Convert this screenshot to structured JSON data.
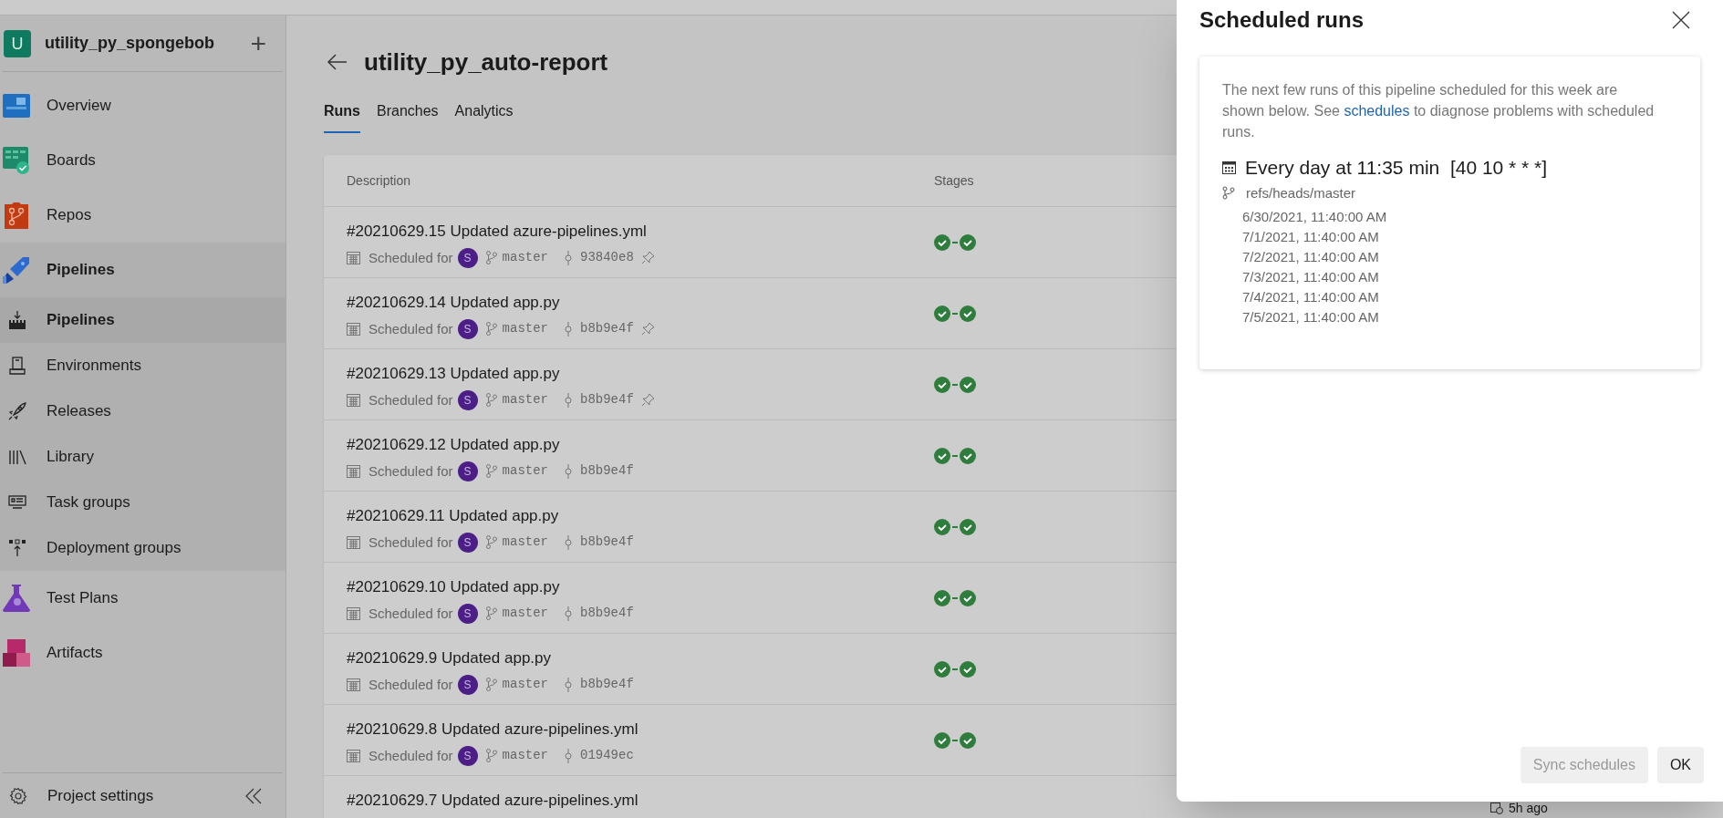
{
  "project": {
    "initial": "U",
    "name": "utility_py_spongebob",
    "add": "+"
  },
  "sidebar": {
    "items": [
      {
        "label": "Overview",
        "selected": false
      },
      {
        "label": "Boards",
        "selected": false
      },
      {
        "label": "Repos",
        "selected": false
      },
      {
        "label": "Pipelines",
        "selected": true,
        "expanded": true,
        "children": [
          {
            "label": "Pipelines",
            "selected": true
          },
          {
            "label": "Environments",
            "selected": false
          },
          {
            "label": "Releases",
            "selected": false
          },
          {
            "label": "Library",
            "selected": false
          },
          {
            "label": "Task groups",
            "selected": false
          },
          {
            "label": "Deployment groups",
            "selected": false
          }
        ]
      },
      {
        "label": "Test Plans",
        "selected": false
      },
      {
        "label": "Artifacts",
        "selected": false
      }
    ],
    "footer": "Project settings"
  },
  "page": {
    "title": "utility_py_auto-report",
    "tabs": [
      {
        "label": "Runs",
        "selected": true
      },
      {
        "label": "Branches",
        "selected": false
      },
      {
        "label": "Analytics",
        "selected": false
      }
    ]
  },
  "table": {
    "columns": [
      "Description",
      "Stages"
    ],
    "rows": [
      {
        "title": "#20210629.15 Updated azure-pipelines.yml",
        "trigger": "Scheduled for",
        "avatar": "S",
        "branch": "master",
        "commit": "93840e8",
        "pinned": true,
        "stages": [
          {
            "passed": true
          },
          {
            "passed": true
          }
        ]
      },
      {
        "title": "#20210629.14 Updated app.py",
        "trigger": "Scheduled for",
        "avatar": "S",
        "branch": "master",
        "commit": "b8b9e4f",
        "pinned": true,
        "stages": [
          {
            "passed": true
          },
          {
            "passed": true
          }
        ]
      },
      {
        "title": "#20210629.13 Updated app.py",
        "trigger": "Scheduled for",
        "avatar": "S",
        "branch": "master",
        "commit": "b8b9e4f",
        "pinned": true,
        "stages": [
          {
            "passed": true
          },
          {
            "passed": true
          }
        ]
      },
      {
        "title": "#20210629.12 Updated app.py",
        "trigger": "Scheduled for",
        "avatar": "S",
        "branch": "master",
        "commit": "b8b9e4f",
        "pinned": false,
        "stages": [
          {
            "passed": true
          },
          {
            "passed": true
          }
        ]
      },
      {
        "title": "#20210629.11 Updated app.py",
        "trigger": "Scheduled for",
        "avatar": "S",
        "branch": "master",
        "commit": "b8b9e4f",
        "pinned": false,
        "stages": [
          {
            "passed": true
          },
          {
            "passed": true
          }
        ]
      },
      {
        "title": "#20210629.10 Updated app.py",
        "trigger": "Scheduled for",
        "avatar": "S",
        "branch": "master",
        "commit": "b8b9e4f",
        "pinned": false,
        "stages": [
          {
            "passed": true
          },
          {
            "passed": true
          }
        ]
      },
      {
        "title": "#20210629.9 Updated app.py",
        "trigger": "Scheduled for",
        "avatar": "S",
        "branch": "master",
        "commit": "b8b9e4f",
        "pinned": false,
        "stages": [
          {
            "passed": true
          },
          {
            "passed": true
          }
        ]
      },
      {
        "title": "#20210629.8 Updated azure-pipelines.yml",
        "trigger": "Scheduled for",
        "avatar": "S",
        "branch": "master",
        "commit": "01949ec",
        "pinned": false,
        "stages": [
          {
            "passed": true
          },
          {
            "passed": true
          }
        ]
      },
      {
        "title": "#20210629.7 Updated azure-pipelines.yml",
        "time": "5h ago"
      }
    ]
  },
  "panel": {
    "title": "Scheduled runs",
    "description": "The next few runs of this pipeline scheduled for this week are shown below. See ",
    "link": "schedules",
    "description_end": " to diagnose problems with scheduled runs.",
    "schedule": {
      "heading": "Every day at 11:35 min  [40 10 * * *]",
      "branch": "refs/heads/master",
      "runs": [
        "6/30/2021, 11:40:00 AM",
        "7/1/2021, 11:40:00 AM",
        "7/2/2021, 11:40:00 AM",
        "7/3/2021, 11:40:00 AM",
        "7/4/2021, 11:40:00 AM",
        "7/5/2021, 11:40:00 AM"
      ]
    },
    "buttons": [
      {
        "label": "Sync schedules",
        "disabled": true
      },
      {
        "label": "OK",
        "disabled": false
      }
    ]
  }
}
